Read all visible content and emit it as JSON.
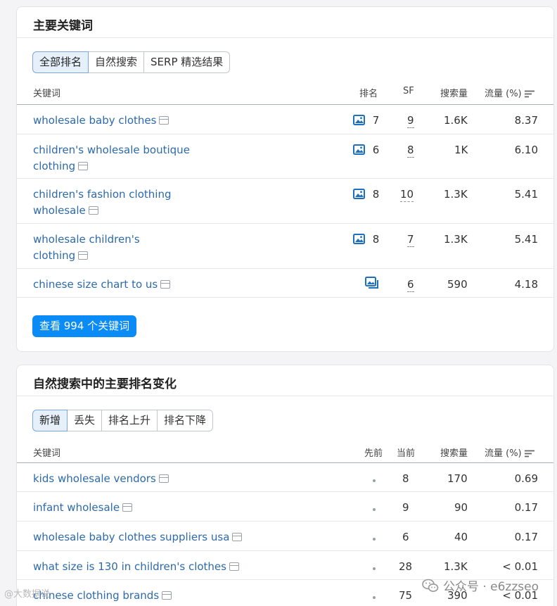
{
  "top_keywords": {
    "title": "主要关键词",
    "tabs": [
      "全部排名",
      "自然搜索",
      "SERP 精选结果"
    ],
    "headers": {
      "keyword": "关键词",
      "rank": "排名",
      "sf": "SF",
      "volume": "搜索量",
      "traffic": "流量 (%)"
    },
    "rows": [
      {
        "keyword": "wholesale baby clothes",
        "rank": "7",
        "sf": "9",
        "volume": "1.6K",
        "traffic": "8.37"
      },
      {
        "keyword": "children's wholesale boutique clothing",
        "rank": "6",
        "sf": "8",
        "volume": "1K",
        "traffic": "6.10"
      },
      {
        "keyword": "children's fashion clothing wholesale",
        "rank": "8",
        "sf": "10",
        "volume": "1.3K",
        "traffic": "5.41"
      },
      {
        "keyword": "wholesale children's clothing",
        "rank": "8",
        "sf": "7",
        "volume": "1.3K",
        "traffic": "5.41"
      },
      {
        "keyword": "chinese size chart to us",
        "rank": "",
        "sf": "6",
        "volume": "590",
        "traffic": "4.18"
      }
    ],
    "cta_label": "查看 994 个关键词"
  },
  "rank_changes": {
    "title": "自然搜索中的主要排名变化",
    "tabs": [
      "新增",
      "丢失",
      "排名上升",
      "排名下降"
    ],
    "headers": {
      "keyword": "关键词",
      "previous": "先前",
      "current": "当前",
      "volume": "搜索量",
      "traffic": "流量 (%)"
    },
    "rows": [
      {
        "keyword": "kids wholesale vendors",
        "current": "8",
        "volume": "170",
        "traffic": "0.69"
      },
      {
        "keyword": "infant wholesale",
        "current": "9",
        "volume": "90",
        "traffic": "0.17"
      },
      {
        "keyword": "wholesale baby clothes suppliers usa",
        "current": "6",
        "volume": "40",
        "traffic": "0.17"
      },
      {
        "keyword": "what size is 130 in children's clothes",
        "current": "28",
        "volume": "1.3K",
        "traffic": "< 0.01"
      },
      {
        "keyword": "chinese clothing brands",
        "current": "75",
        "volume": "390",
        "traffic": "< 0.01"
      }
    ]
  },
  "watermark": {
    "text": "公众号 · e6zzseo",
    "left_text": "@大数据说"
  },
  "colors": {
    "link": "#2d6aaa",
    "accent": "#0a8bf5",
    "tab_active_bg": "#e6f0fb"
  }
}
